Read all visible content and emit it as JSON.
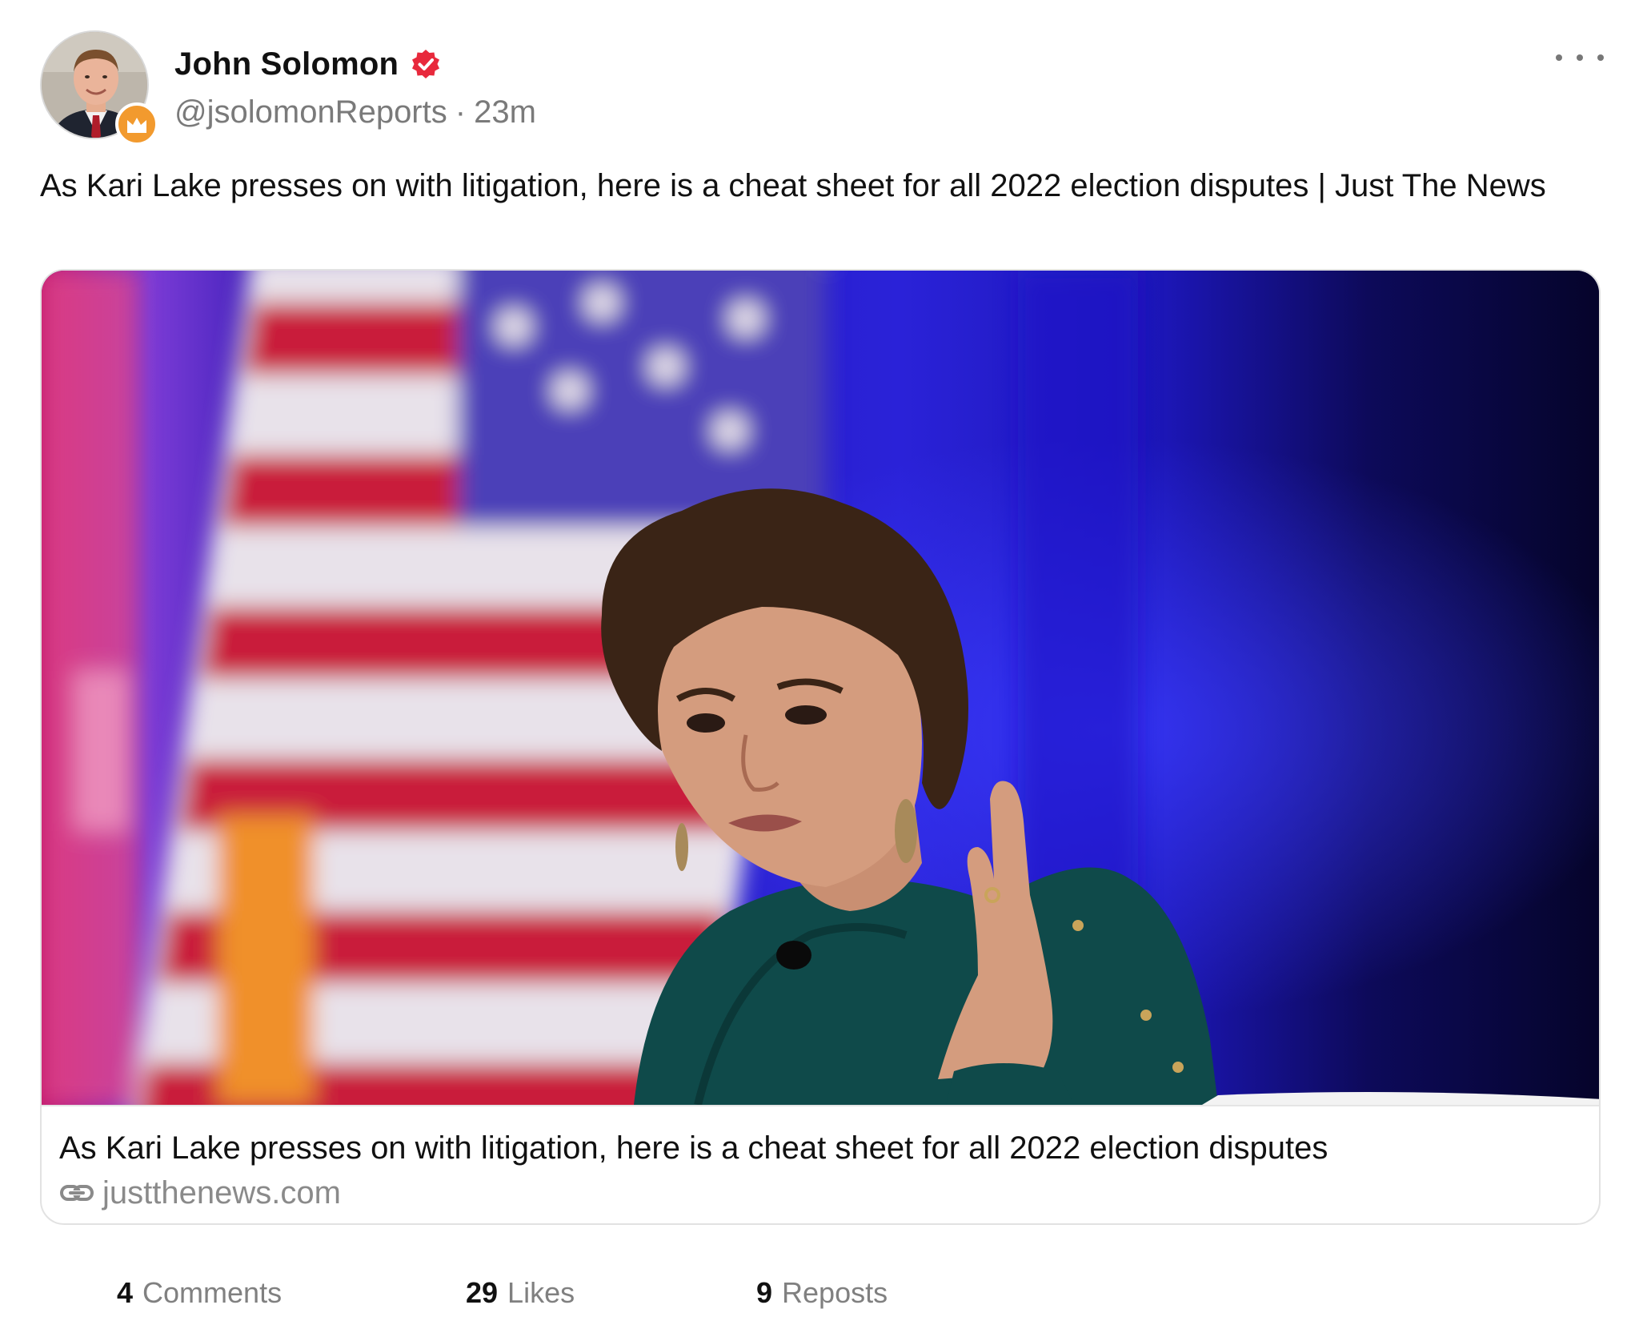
{
  "post": {
    "author": {
      "name": "John Solomon",
      "handle": "@jsolomonReports",
      "time": "23m",
      "separator": "·",
      "verified_icon": "verified-check-icon",
      "badge_icon": "crown-icon"
    },
    "text": "As Kari Lake presses on with litigation, here is a cheat sheet for all 2022 election disputes   | Just The News",
    "more_icon": "more-horizontal-icon"
  },
  "link_card": {
    "title": "As Kari Lake presses on with litigation, here is a cheat sheet for all 2022 election disputes",
    "domain": "justthenews.com",
    "link_icon": "link-icon"
  },
  "stats": {
    "comments": {
      "count": "4",
      "label": "Comments"
    },
    "likes": {
      "count": "29",
      "label": "Likes"
    },
    "reposts": {
      "count": "9",
      "label": "Reposts"
    }
  },
  "colors": {
    "verified": "#e8293c",
    "badge": "#f29a2e",
    "muted_text": "#7a7a7a",
    "card_border": "#e2e2e2"
  }
}
